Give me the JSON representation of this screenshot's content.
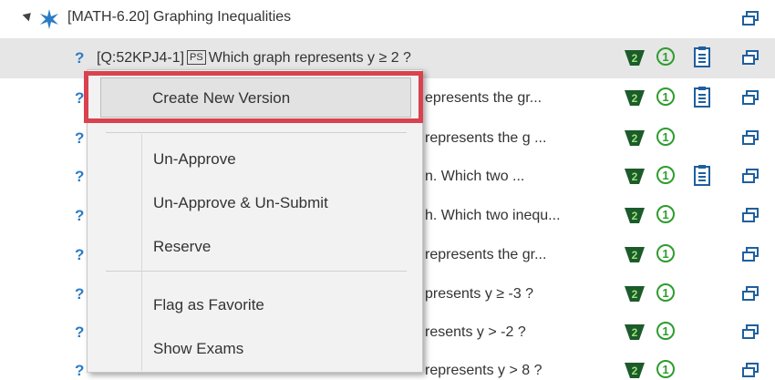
{
  "header": {
    "title": "[MATH-6.20] Graphing Inequalities"
  },
  "rows": [
    {
      "id": "[Q:52KPJ4-1]",
      "tag": "PS",
      "text": "Which graph represents y ≥ 2 ?",
      "clipboard": true
    },
    {
      "visible_text": "epresents the gr...",
      "clipboard": true
    },
    {
      "visible_text": "represents the g ...",
      "clipboard": false
    },
    {
      "visible_text": "n. Which two ...",
      "clipboard": true
    },
    {
      "visible_text": "h. Which two inequ...",
      "clipboard": false
    },
    {
      "visible_text": "represents the gr...",
      "clipboard": false
    },
    {
      "visible_text": "presents y ≥ -3 ?",
      "clipboard": false
    },
    {
      "visible_text": "resents y > -2 ?",
      "clipboard": false
    },
    {
      "visible_text": "represents y > 8 ?",
      "clipboard": false
    }
  ],
  "badge": {
    "one_label": "1"
  },
  "menu": {
    "items": [
      "Create New Version",
      "Un-Approve",
      "Un-Approve & Un-Submit",
      "Reserve",
      "Flag as Favorite",
      "Show Exams"
    ]
  },
  "colors": {
    "accent_blue": "#2b7bc4",
    "badge_green": "#2e9c2e",
    "highlight_red": "#d9424f"
  }
}
